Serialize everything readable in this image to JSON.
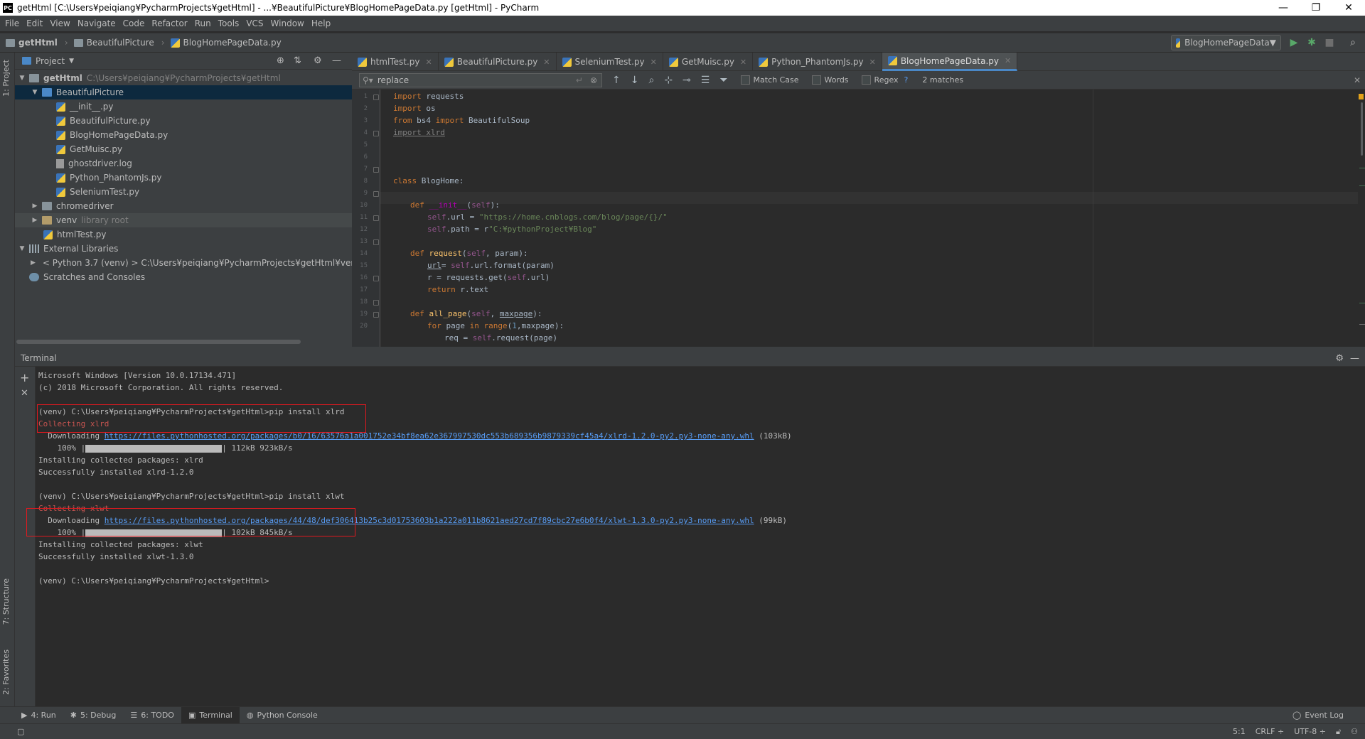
{
  "window": {
    "title": "getHtml [C:\\Users¥peiqiang¥PycharmProjects¥getHtml] - ...¥BeautifulPicture¥BlogHomePageData.py [getHtml] - PyCharm",
    "app_icon": "PC",
    "controls": [
      "—",
      "❐",
      "✕"
    ]
  },
  "menu": [
    "File",
    "Edit",
    "View",
    "Navigate",
    "Code",
    "Refactor",
    "Run",
    "Tools",
    "VCS",
    "Window",
    "Help"
  ],
  "breadcrumb": [
    "getHtml",
    "BeautifulPicture",
    "BlogHomePageData.py"
  ],
  "run_config": "BlogHomePageData",
  "project": {
    "header": "Project",
    "tree": [
      {
        "label": "getHtml",
        "path": "C:\\Users¥peiqiang¥PycharmProjects¥getHtml"
      },
      {
        "label": "BeautifulPicture"
      },
      {
        "label": "__init__.py"
      },
      {
        "label": "BeautifulPicture.py"
      },
      {
        "label": "BlogHomePageData.py"
      },
      {
        "label": "GetMuisc.py"
      },
      {
        "label": "ghostdriver.log"
      },
      {
        "label": "Python_PhantomJs.py"
      },
      {
        "label": "SeleniumTest.py"
      },
      {
        "label": "chromedriver"
      },
      {
        "label": "venv",
        "note": "library root"
      },
      {
        "label": "htmlTest.py"
      },
      {
        "label": "External Libraries"
      },
      {
        "label": "< Python 3.7 (venv) > C:\\Users¥peiqiang¥PycharmProjects¥getHtml¥venv¥Scripts"
      },
      {
        "label": "Scratches and Consoles"
      }
    ]
  },
  "side_tabs": {
    "project": "1: Project",
    "structure": "7: Structure",
    "favorites": "2: Favorites"
  },
  "editor": {
    "tabs": [
      "htmlTest.py",
      "BeautifulPicture.py",
      "SeleniumTest.py",
      "GetMuisc.py",
      "Python_PhantomJs.py",
      "BlogHomePageData.py"
    ],
    "active_tab": "BlogHomePageData.py",
    "find": {
      "query": "replace",
      "match_case": "Match Case",
      "words": "Words",
      "regex": "Regex",
      "help": "?",
      "matches": "2 matches"
    },
    "line_numbers": [
      "1",
      "2",
      "3",
      "4",
      "5",
      "6",
      "7",
      "8",
      "9",
      "10",
      "11",
      "12",
      "13",
      "14",
      "15",
      "16",
      "17",
      "18",
      "19",
      "20"
    ]
  },
  "terminal": {
    "header": "Terminal",
    "lines": {
      "l1": "Microsoft Windows [Version 10.0.17134.471]",
      "l2": "(c) 2018 Microsoft Corporation. All rights reserved.",
      "l3": "(venv) C:\\Users¥peiqiang¥PycharmProjects¥getHtml>pip install xlrd",
      "l4": "Collecting xlrd",
      "l5a": "  Downloading ",
      "l5link": "https://files.pythonhosted.org/packages/b0/16/63576a1a001752e34bf8ea62e367997530dc553b689356b9879339cf45a4/xlrd-1.2.0-py2.py3-none-any.whl",
      "l5b": " (103kB)",
      "l6a": "    100% |",
      "l6b": "| 112kB 923kB/s",
      "l7": "Installing collected packages: xlrd",
      "l8": "Successfully installed xlrd-1.2.0",
      "l9": "(venv) C:\\Users¥peiqiang¥PycharmProjects¥getHtml>pip install xlwt",
      "l10": "Collecting xlwt",
      "l11a": "  Downloading ",
      "l11link": "https://files.pythonhosted.org/packages/44/48/def306413b25c3d01753603b1a222a011b8621aed27cd7f89cbc27e6b0f4/xlwt-1.3.0-py2.py3-none-any.whl",
      "l11b": " (99kB)",
      "l12a": "    100% |",
      "l12b": "| 102kB 845kB/s",
      "l13": "Installing collected packages: xlwt",
      "l14": "Successfully installed xlwt-1.3.0",
      "l15": "(venv) C:\\Users¥peiqiang¥PycharmProjects¥getHtml>"
    },
    "progress": [
      1.0,
      1.0
    ]
  },
  "bottom_tabs": [
    "4: Run",
    "5: Debug",
    "6: TODO",
    "Terminal",
    "Python Console"
  ],
  "event_log": "Event Log",
  "status": {
    "position": "5:1",
    "line_sep": "CRLF ÷",
    "encoding": "UTF-8 ÷"
  }
}
